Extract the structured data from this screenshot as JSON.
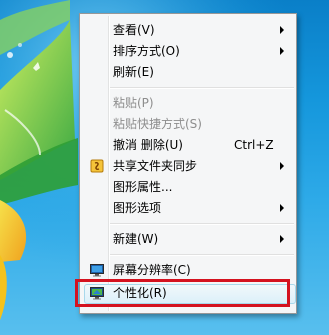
{
  "menu": {
    "items": [
      {
        "label": "查看(V)",
        "submenu": true
      },
      {
        "label": "排序方式(O)",
        "submenu": true
      },
      {
        "label": "刷新(E)"
      },
      {
        "label": "粘贴(P)",
        "disabled": true
      },
      {
        "label": "粘贴快捷方式(S)",
        "disabled": true
      },
      {
        "label": "撤消 删除(U)",
        "shortcut": "Ctrl+Z"
      },
      {
        "label": "共享文件夹同步",
        "submenu": true,
        "icon": "sync-folder-icon"
      },
      {
        "label": "图形属性..."
      },
      {
        "label": "图形选项",
        "submenu": true
      },
      {
        "label": "新建(W)",
        "submenu": true
      },
      {
        "label": "屏幕分辨率(C)",
        "icon": "screen-resolution-icon"
      },
      {
        "label": "个性化(R)",
        "icon": "personalize-icon",
        "highlighted": true
      }
    ]
  },
  "colors": {
    "highlight_border": "#d4121f",
    "menu_background": "#f5f6f7"
  }
}
